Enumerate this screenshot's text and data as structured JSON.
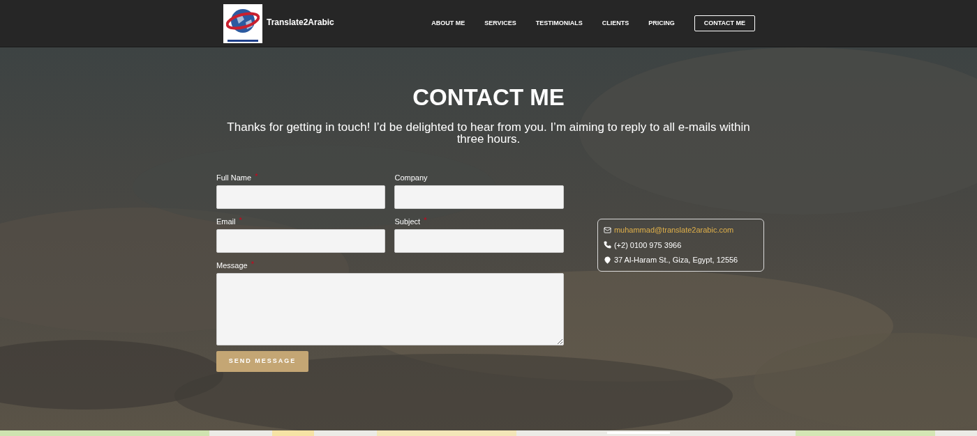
{
  "header": {
    "brand": "Translate2Arabic",
    "nav": [
      {
        "label": "ABOUT ME",
        "kind": "link"
      },
      {
        "label": "SERVICES",
        "kind": "link"
      },
      {
        "label": "TESTIMONIALS",
        "kind": "link"
      },
      {
        "label": "CLIENTS",
        "kind": "link"
      },
      {
        "label": "PRICING",
        "kind": "link"
      },
      {
        "label": "CONTACT ME",
        "kind": "button"
      }
    ]
  },
  "hero": {
    "title": "CONTACT ME",
    "subtitle": "Thanks for getting in touch! I’d be delighted to hear from you. I’m aiming to reply to all e-mails within three hours."
  },
  "form": {
    "required_mark": "*",
    "fields": [
      {
        "label": "Full Name",
        "required": true,
        "kind": "input"
      },
      {
        "label": "Company",
        "required": false,
        "kind": "input"
      },
      {
        "label": "Email",
        "required": true,
        "kind": "input"
      },
      {
        "label": "Subject",
        "required": true,
        "kind": "input"
      },
      {
        "label": "Message",
        "required": true,
        "kind": "textarea"
      }
    ],
    "submit": "SEND MESSAGE"
  },
  "contact": [
    {
      "kind": "email",
      "text": "muhammad@translate2arabic.com"
    },
    {
      "kind": "phone",
      "text": "(+2) 0100 975 3966"
    },
    {
      "kind": "address",
      "text": "37 Al-Haram St., Giza, Egypt, 12556"
    }
  ]
}
